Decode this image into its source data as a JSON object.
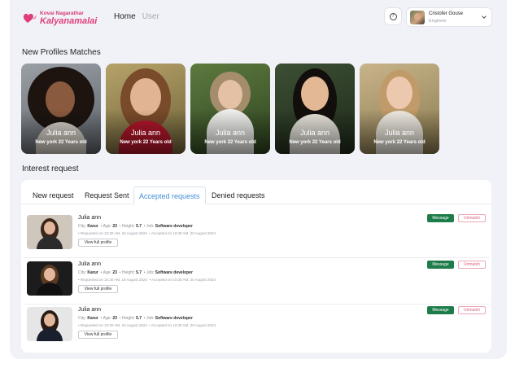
{
  "brand": {
    "line1": "Kovai Nagarathar",
    "line2": "Kalyanamalai",
    "accent": "#e03e7a"
  },
  "nav": {
    "home": "Home",
    "user": "User"
  },
  "header": {
    "help_icon": "question-circle-icon",
    "user_name": "Cristofer Gouse",
    "user_role": "Engineer"
  },
  "matches": {
    "title": "New Profiles Matches",
    "cards": [
      {
        "name": "Julia ann",
        "info": "New york 22 Years old"
      },
      {
        "name": "Julia ann",
        "info": "New york 22 Years old"
      },
      {
        "name": "Julia ann",
        "info": "New york 22 Years old"
      },
      {
        "name": "Julia ann",
        "info": "New york 22 Years old"
      },
      {
        "name": "Julia ann",
        "info": "New york 22 Years old"
      }
    ]
  },
  "interest": {
    "title": "Interest request",
    "tabs": [
      "New request",
      "Request Sent",
      "Accepted requests",
      "Denied requests"
    ],
    "active_tab": "Accepted requests",
    "rows": [
      {
        "name": "Julia ann",
        "city_label": "City:",
        "city": "Karur",
        "age_label": "Age:",
        "age": "23",
        "height_label": "Height:",
        "height": "5.7",
        "job_label": "Job:",
        "job": "Software developer",
        "requested": "Requested on 10:30 AM, 18 August 2024",
        "accepted": "Accepted on 10:30 AM, 20 August 2024",
        "view": "View full profile",
        "message": "Message",
        "unmatch": "Unmatch"
      },
      {
        "name": "Julia ann",
        "city_label": "City:",
        "city": "Karur",
        "age_label": "Age:",
        "age": "23",
        "height_label": "Height:",
        "height": "5.7",
        "job_label": "Job:",
        "job": "Software developer",
        "requested": "Requested on 10:30 AM, 18 August 2024",
        "accepted": "Accepted on 10:30 AM, 20 August 2024",
        "view": "View full profile",
        "message": "Message",
        "unmatch": "Unmatch"
      },
      {
        "name": "Julia ann",
        "city_label": "City:",
        "city": "Karur",
        "age_label": "Age:",
        "age": "23",
        "height_label": "Height:",
        "height": "5.7",
        "job_label": "Job:",
        "job": "Software developer",
        "requested": "Requested on 10:30 AM, 18 August 2024",
        "accepted": "Accepted on 10:30 AM, 20 August 2024",
        "view": "View full profile",
        "message": "Message",
        "unmatch": "Unmatch"
      }
    ]
  },
  "colors": {
    "message_button": "#1d7c4a",
    "unmatch_border": "#e9a8b6",
    "active_tab": "#3f8fd8"
  }
}
